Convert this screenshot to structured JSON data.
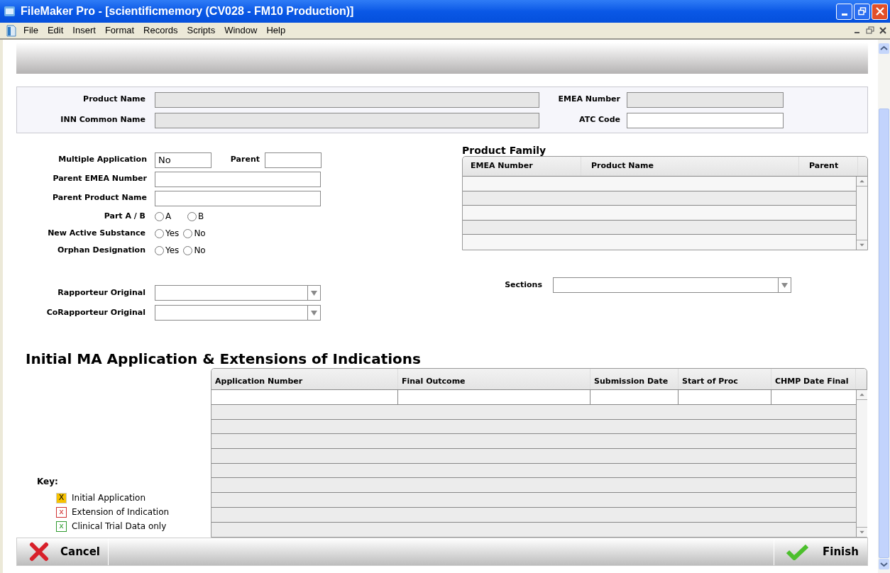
{
  "window": {
    "title": "FileMaker Pro - [scientificmemory (CV028 - FM10 Production)]"
  },
  "menu": [
    "File",
    "Edit",
    "Insert",
    "Format",
    "Records",
    "Scripts",
    "Window",
    "Help"
  ],
  "product_panel": {
    "fields": [
      {
        "label": "Product Name",
        "editable": false
      },
      {
        "label": "EMEA Number",
        "editable": false
      },
      {
        "label": "INN Common Name",
        "editable": false
      },
      {
        "label": "ATC Code",
        "editable": true
      }
    ]
  },
  "application": {
    "multiple_label": "Multiple Application",
    "multiple_value": "No",
    "parent_label": "Parent",
    "text_fields": [
      {
        "label": "Parent EMEA Number"
      },
      {
        "label": "Parent Product Name"
      }
    ],
    "radio_groups": [
      {
        "label": "Part A / B",
        "options": [
          {
            "label": "A",
            "selected": false
          },
          {
            "label": "B",
            "selected": false
          }
        ]
      },
      {
        "label": "New Active Substance",
        "options": [
          {
            "label": "Yes",
            "selected": false
          },
          {
            "label": "No",
            "selected": false
          }
        ]
      },
      {
        "label": "Orphan Designation",
        "options": [
          {
            "label": "Yes",
            "selected": false
          },
          {
            "label": "No",
            "selected": false
          }
        ]
      }
    ],
    "dropdowns": [
      {
        "label": "Rapporteur Original"
      },
      {
        "label": "CoRapporteur Original"
      }
    ]
  },
  "product_family": {
    "title": "Product Family",
    "columns": [
      "EMEA Number",
      "Product Name",
      "Parent"
    ]
  },
  "sections": {
    "label": "Sections"
  },
  "indications": {
    "title": "Initial MA Application & Extensions of Indications",
    "columns": [
      "Application Number",
      "Final Outcome",
      "Submission Date",
      "Start of Proc",
      "CHMP Date Final"
    ]
  },
  "key": {
    "title": "Key:",
    "items": [
      {
        "mark": "X",
        "label": "Initial Application",
        "kind": "filled",
        "color": "#f7c200"
      },
      {
        "mark": "x",
        "label": "Extension of Indication",
        "kind": "outlined",
        "color": "#d03030"
      },
      {
        "mark": "x",
        "label": "Clinical Trial Data only",
        "kind": "outlined",
        "color": "#2f9a2f"
      }
    ]
  },
  "footer": {
    "cancel": "Cancel",
    "finish": "Finish"
  }
}
